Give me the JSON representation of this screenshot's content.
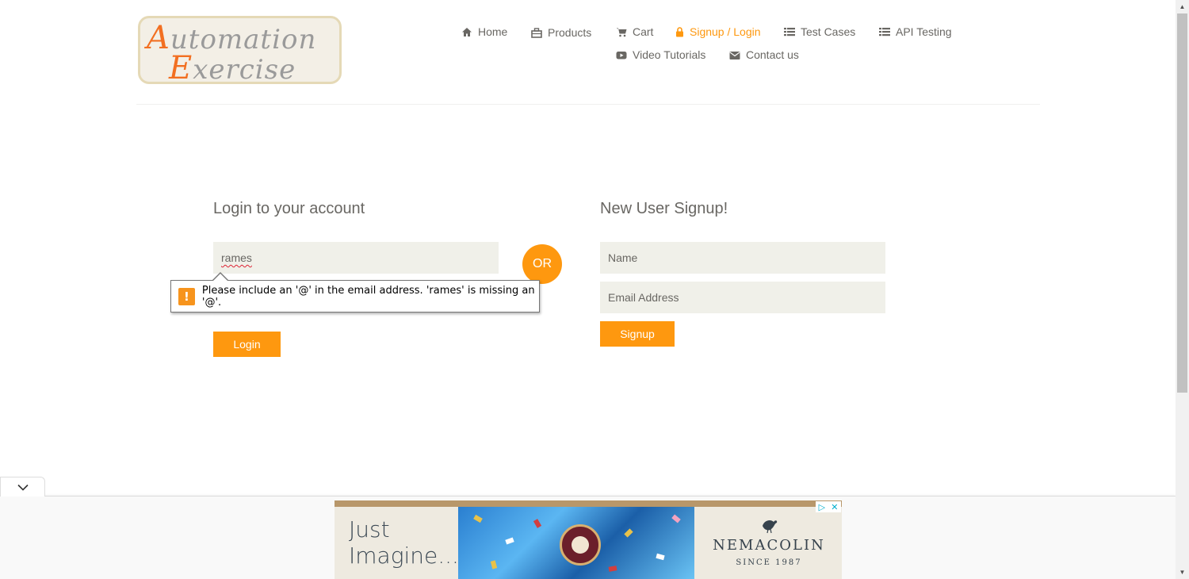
{
  "logo": {
    "line1_cap": "A",
    "line1_rest": "utomation",
    "line2_cap": "E",
    "line2_rest": "xercise"
  },
  "nav": {
    "items": [
      {
        "label": "Home",
        "icon": "home-icon"
      },
      {
        "label": "Products",
        "icon": "products-icon"
      },
      {
        "label": "Cart",
        "icon": "cart-icon"
      },
      {
        "label": "Signup / Login",
        "icon": "lock-icon",
        "active": true
      },
      {
        "label": "Test Cases",
        "icon": "list-icon"
      },
      {
        "label": "API Testing",
        "icon": "list-icon"
      },
      {
        "label": "Video Tutorials",
        "icon": "youtube-play-icon"
      },
      {
        "label": "Contact us",
        "icon": "envelope-icon"
      }
    ]
  },
  "login": {
    "title": "Login to your account",
    "email_value": "rames",
    "button": "Login"
  },
  "or_label": "OR",
  "signup": {
    "title": "New User Signup!",
    "name_placeholder": "Name",
    "email_placeholder": "Email Address",
    "button": "Signup"
  },
  "validation_tooltip": {
    "icon": "warning-icon",
    "message": "Please include an '@' in the email address. 'rames' is missing an '@'."
  },
  "ad": {
    "left_line1": "Just",
    "left_line2": "Imagine...",
    "brand": "NEMACOLIN",
    "since": "SINCE 1987"
  },
  "colors": {
    "accent": "#fe980f",
    "text": "#696763",
    "field_bg": "#f0f0e9"
  }
}
